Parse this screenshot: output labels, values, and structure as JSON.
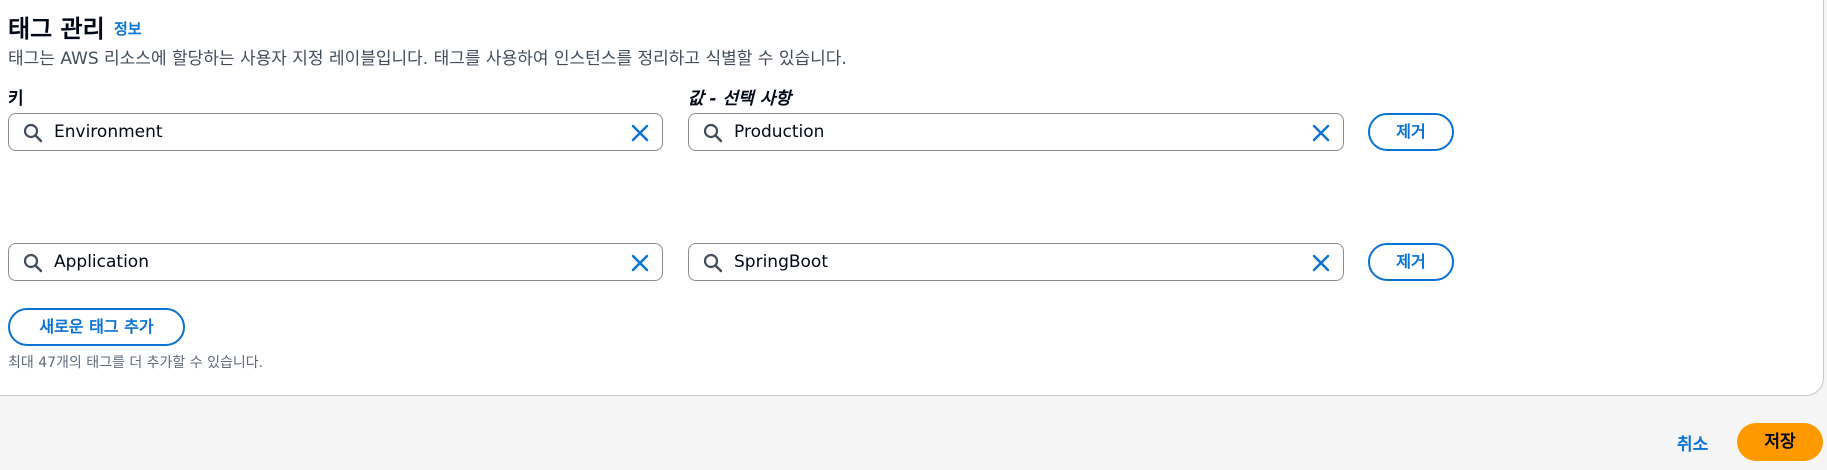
{
  "section": {
    "title": "태그 관리",
    "info_link": "정보",
    "description": "태그는 AWS 리소스에 할당하는 사용자 지정 레이블입니다. 태그를 사용하여 인스턴스를 정리하고 식별할 수 있습니다."
  },
  "columns": {
    "key_label": "키",
    "value_label": "값 - 선택 사항"
  },
  "tags": [
    {
      "key": "Environment",
      "value": "Production",
      "remove_label": "제거"
    },
    {
      "key": "Application",
      "value": "SpringBoot",
      "remove_label": "제거"
    }
  ],
  "add_tag_label": "새로운 태그 추가",
  "limit_hint": "최대 47개의 태그를 더 추가할 수 있습니다.",
  "footer": {
    "cancel_label": "취소",
    "save_label": "저장"
  },
  "colors": {
    "accent": "#0972d3",
    "primary_button": "#ff9900"
  },
  "icons": {
    "search": "search-icon",
    "clear": "clear-icon"
  }
}
